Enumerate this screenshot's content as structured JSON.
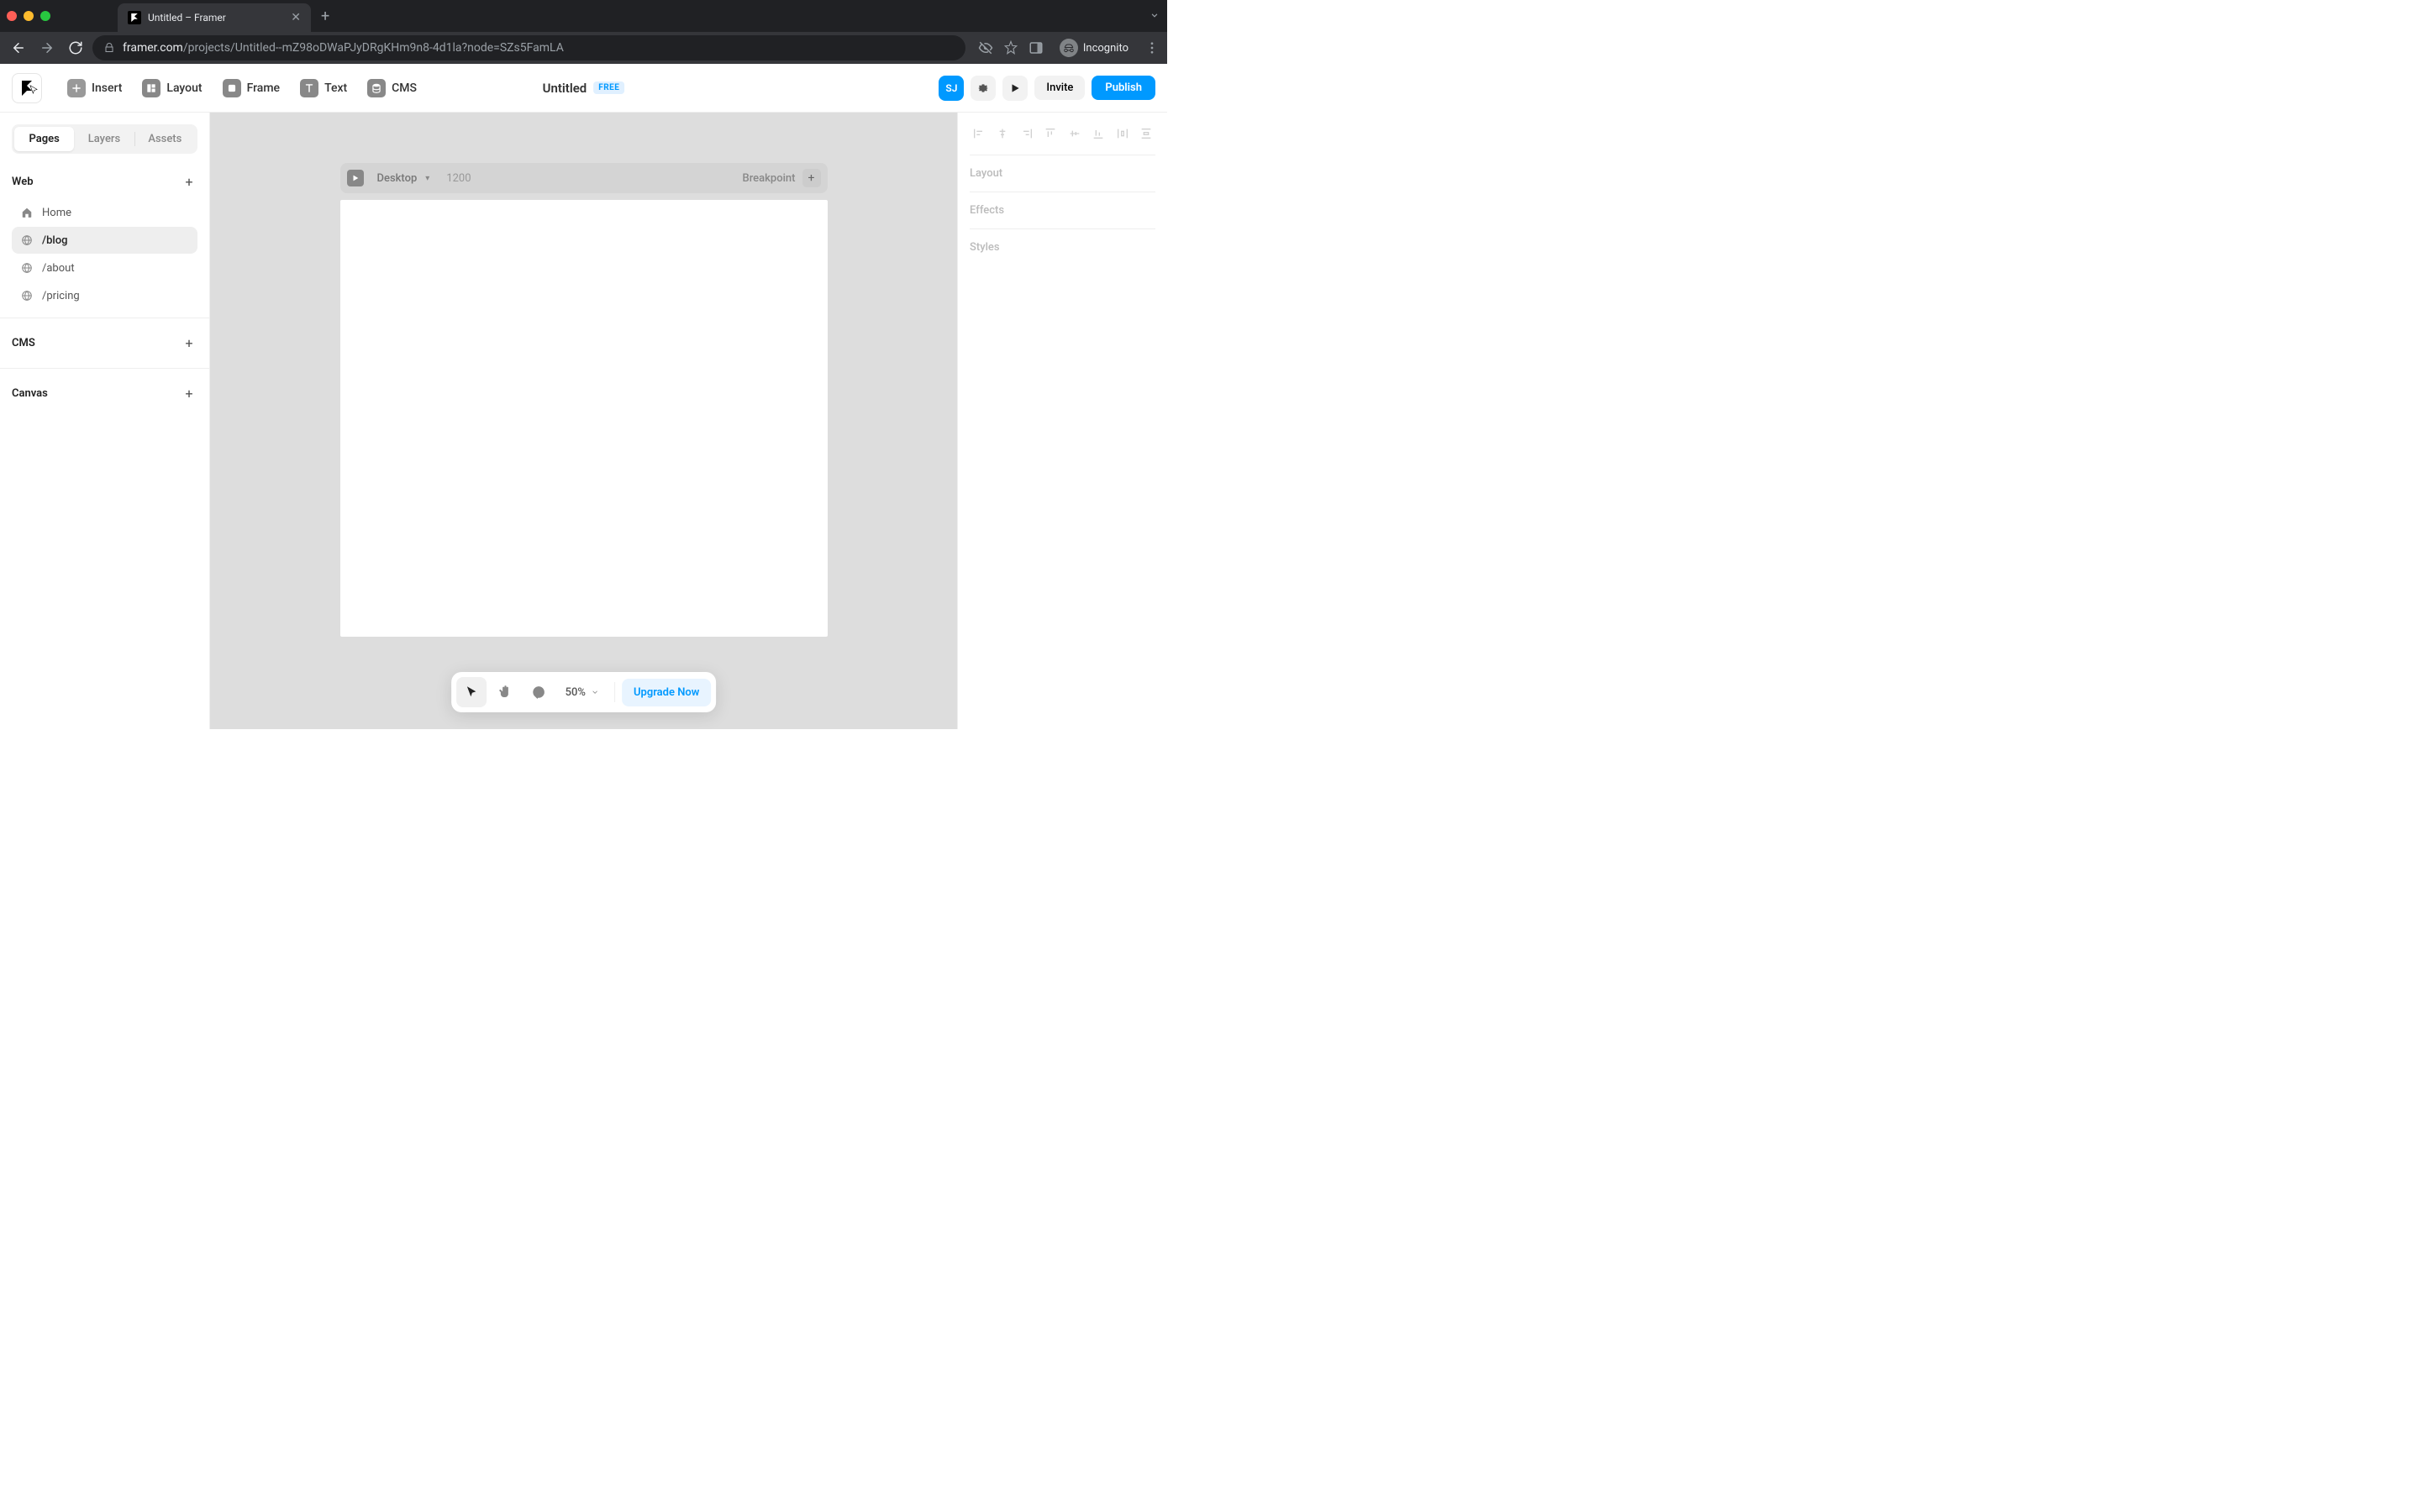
{
  "browser": {
    "tab_title": "Untitled – Framer",
    "url_domain": "framer.com",
    "url_path": "/projects/Untitled--mZ98oDWaPJyDRgKHm9n8-4d1la?node=SZs5FamLA",
    "incognito_label": "Incognito"
  },
  "toolbar": {
    "insert": "Insert",
    "layout": "Layout",
    "frame": "Frame",
    "text": "Text",
    "cms": "CMS",
    "doc_title": "Untitled",
    "plan_badge": "FREE",
    "avatar_initials": "SJ",
    "invite": "Invite",
    "publish": "Publish"
  },
  "left_panel": {
    "tabs": [
      "Pages",
      "Layers",
      "Assets"
    ],
    "active_tab_index": 0,
    "sections": {
      "web": {
        "title": "Web",
        "pages": [
          {
            "label": "Home",
            "icon": "home"
          },
          {
            "label": "/blog",
            "icon": "globe",
            "active": true
          },
          {
            "label": "/about",
            "icon": "globe"
          },
          {
            "label": "/pricing",
            "icon": "globe"
          }
        ]
      },
      "cms": {
        "title": "CMS"
      },
      "canvas": {
        "title": "Canvas"
      }
    }
  },
  "canvas": {
    "breakpoint_label": "Desktop",
    "breakpoint_width": "1200",
    "breakpoint_text": "Breakpoint"
  },
  "right_panel": {
    "sections": [
      "Layout",
      "Effects",
      "Styles"
    ]
  },
  "bottom_bar": {
    "zoom": "50%",
    "upgrade": "Upgrade Now"
  }
}
